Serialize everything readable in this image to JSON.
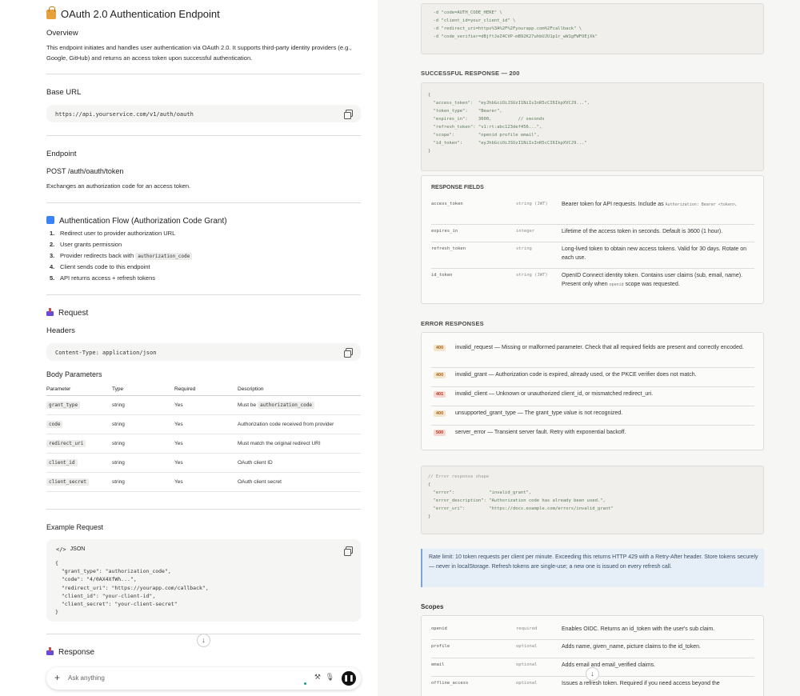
{
  "left": {
    "title": "OAuth 2.0 Authentication Endpoint",
    "overview": {
      "heading": "Overview",
      "text": "This endpoint initiates and handles user authentication via OAuth 2.0. It supports third-party identity providers (e.g., Google, GitHub) and returns an access token upon successful authentication."
    },
    "base_url": {
      "heading": "Base URL",
      "value": "https://api.yourservice.com/v1/auth/oauth"
    },
    "endpoint": {
      "heading": "Endpoint",
      "method_path": "POST /auth/oauth/token",
      "text": "Exchanges an authorization code for an access token."
    },
    "flow": {
      "heading": "Authentication Flow (Authorization Code Grant)",
      "steps": [
        {
          "n": "1.",
          "text": "Redirect user to provider authorization URL",
          "code": ""
        },
        {
          "n": "2.",
          "text": "User grants permission",
          "code": ""
        },
        {
          "n": "3.",
          "text": "Provider redirects back with",
          "code": "authorization_code"
        },
        {
          "n": "4.",
          "text": "Client sends code to this endpoint",
          "code": ""
        },
        {
          "n": "5.",
          "text": "API returns access + refresh tokens",
          "code": ""
        }
      ]
    },
    "request": {
      "heading": "Request",
      "headers_heading": "Headers",
      "header_value": "Content-Type: application/json",
      "body_heading": "Body Parameters",
      "columns": [
        "Parameter",
        "Type",
        "Required",
        "Description"
      ],
      "rows": [
        {
          "param": "grant_type",
          "type": "string",
          "required": "Yes",
          "desc": "Must be",
          "desc_code": "authorization_code"
        },
        {
          "param": "code",
          "type": "string",
          "required": "Yes",
          "desc": "Authorization code received from provider",
          "desc_code": ""
        },
        {
          "param": "redirect_uri",
          "type": "string",
          "required": "Yes",
          "desc": "Must match the original redirect URI",
          "desc_code": ""
        },
        {
          "param": "client_id",
          "type": "string",
          "required": "Yes",
          "desc": "OAuth client ID",
          "desc_code": ""
        },
        {
          "param": "client_secret",
          "type": "string",
          "required": "Yes",
          "desc": "OAuth client secret",
          "desc_code": ""
        }
      ]
    },
    "example": {
      "heading": "Example Request",
      "lang": "JSON",
      "lines": [
        "{",
        "  \"grant_type\": \"authorization_code\",",
        "  \"code\": \"4/0AX4XfWh...\",",
        "  \"redirect_uri\": \"https://yourapp.com/callback\",",
        "  \"client_id\": \"your-client-id\",",
        "  \"client_secret\": \"your-client-secret\"",
        "}"
      ]
    },
    "response_heading": "Response",
    "composer_placeholder": "Ask anything"
  },
  "right": {
    "top_code": [
      "  -d \"code=AUTH_CODE_HERE\" \\",
      "  -d \"client_id=your_client_id\" \\",
      "  -d \"redirect_uri=https%3A%2F%2Fyourapp.com%2Fcallback\" \\",
      "  -d \"code_verifier=dBjftJeZ4CVP-mB92K27uhbUJU1p1r_wW1gFWFOEjXk\""
    ],
    "success_heading": "SUCCESSFUL RESPONSE — 200",
    "success_code": [
      "{",
      "  \"access_token\":  \"eyJhbGciOiJSUzI1NiIsInR5cCI6IkpXVCJ9...\",",
      "  \"token_type\":    \"Bearer\",",
      "  \"expires_in\":    3600,          // seconds",
      "  \"refresh_token\": \"v1:rt:abc123def456...\",",
      "  \"scope\":         \"openid profile email\",",
      "  \"id_token\":      \"eyJhbGciOiJSUzI1NiIsInR5cCI6IkpXVCJ9...\"",
      "}"
    ],
    "fields": {
      "heading": "RESPONSE FIELDS",
      "rows": [
        {
          "key": "access_token",
          "type": "string (JWT)",
          "desc": "Bearer token for API requests. Include as",
          "code": "Authorization: Bearer <token>",
          "desc2": "."
        },
        {
          "key": "expires_in",
          "type": "integer",
          "desc": "Lifetime of the access token in seconds. Default is 3600 (1 hour).",
          "code": "",
          "desc2": ""
        },
        {
          "key": "refresh_token",
          "type": "string",
          "desc": "Long-lived token to obtain new access tokens. Valid for 30 days. Rotate on each use.",
          "code": "",
          "desc2": ""
        },
        {
          "key": "id_token",
          "type": "string (JWT)",
          "desc": "OpenID Connect identity token. Contains user claims (sub, email, name). Present only when",
          "code": "openid",
          "desc2": "scope was requested."
        }
      ]
    },
    "errors": {
      "heading": "ERROR RESPONSES",
      "rows": [
        {
          "code": "400",
          "text": "invalid_request — Missing or malformed parameter. Check that all required fields are present and correctly encoded."
        },
        {
          "code": "400",
          "text": "invalid_grant — Authorization code is expired, already used, or the PKCE verifier does not match."
        },
        {
          "code": "401",
          "text": "invalid_client — Unknown or unauthorized client_id, or mismatched redirect_uri."
        },
        {
          "code": "400",
          "text": "unsupported_grant_type — The grant_type value is not recognized."
        },
        {
          "code": "500",
          "text": "server_error — Transient server fault. Retry with exponential backoff."
        }
      ]
    },
    "error_code": [
      "// Error response shape",
      "{",
      "  \"error\":             \"invalid_grant\",",
      "  \"error_description\": \"Authorization code has already been used.\",",
      "  \"error_uri\":         \"https://docs.example.com/errors/invalid_grant\"",
      "}"
    ],
    "callout": "Rate limit: 10 token requests per client per minute. Exceeding this returns HTTP 429 with a Retry-After header. Store tokens securely — never in localStorage. Refresh tokens are single-use; a new one is issued on every refresh call.",
    "scopes": {
      "heading": "Scopes",
      "rows": [
        {
          "key": "openid",
          "type": "required",
          "desc": "Enables OIDC. Returns an id_token with the user's sub claim."
        },
        {
          "key": "profile",
          "type": "optional",
          "desc": "Adds name, given_name, picture claims to the id_token."
        },
        {
          "key": "email",
          "type": "optional",
          "desc": "Adds email and email_verified claims."
        },
        {
          "key": "offline_access",
          "type": "optional",
          "desc": "Issues a refresh token. Required if you need access beyond the"
        }
      ]
    }
  },
  "colors": {
    "accent_blue": "#3b82f6",
    "code_green": "#3a7a2a",
    "error_orange": "#a0641e",
    "error_red": "#b33a24"
  }
}
